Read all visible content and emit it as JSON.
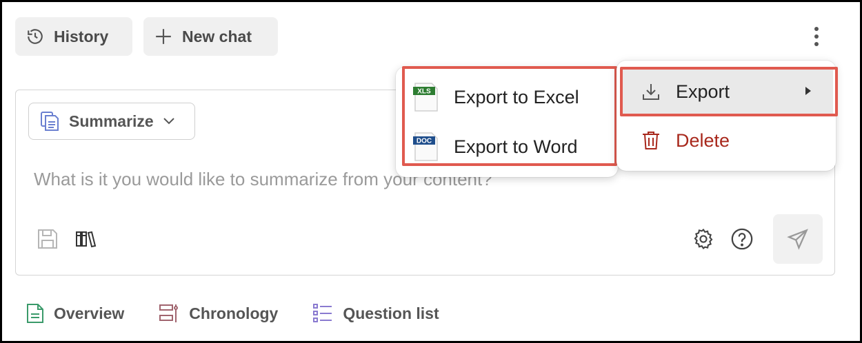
{
  "header": {
    "history_label": "History",
    "new_chat_label": "New chat",
    "icons": {
      "history": "history-icon",
      "new_chat": "plus-icon",
      "more": "kebab-menu-icon"
    }
  },
  "composer": {
    "mode_label": "Summarize",
    "prompt_placeholder": "What is it you would like to summarize from your content?",
    "icons": [
      "document-stack-icon",
      "chevron-down-icon",
      "save-icon",
      "library-icon",
      "settings-icon",
      "help-icon",
      "send-icon"
    ]
  },
  "context_menu": {
    "export_label": "Export",
    "delete_label": "Delete",
    "delete_color": "#a8281c",
    "icons": [
      "download-icon",
      "caret-right-icon",
      "trash-icon"
    ]
  },
  "export_submenu": {
    "items": [
      {
        "label": "Export to Excel",
        "badge": "XLS",
        "badge_color": "#2e7d32"
      },
      {
        "label": "Export to Word",
        "badge": "DOC",
        "badge_color": "#1f4e8c"
      }
    ]
  },
  "bottom_tabs": {
    "items": [
      {
        "label": "Overview",
        "icon": "document-icon",
        "color": "#3a9a6a"
      },
      {
        "label": "Chronology",
        "icon": "timeline-icon",
        "color": "#a0646e"
      },
      {
        "label": "Question list",
        "icon": "checklist-icon",
        "color": "#8a7ad0"
      }
    ]
  },
  "colors": {
    "highlight": "#e05a4f",
    "menu_hover": "#e9e9e9"
  }
}
